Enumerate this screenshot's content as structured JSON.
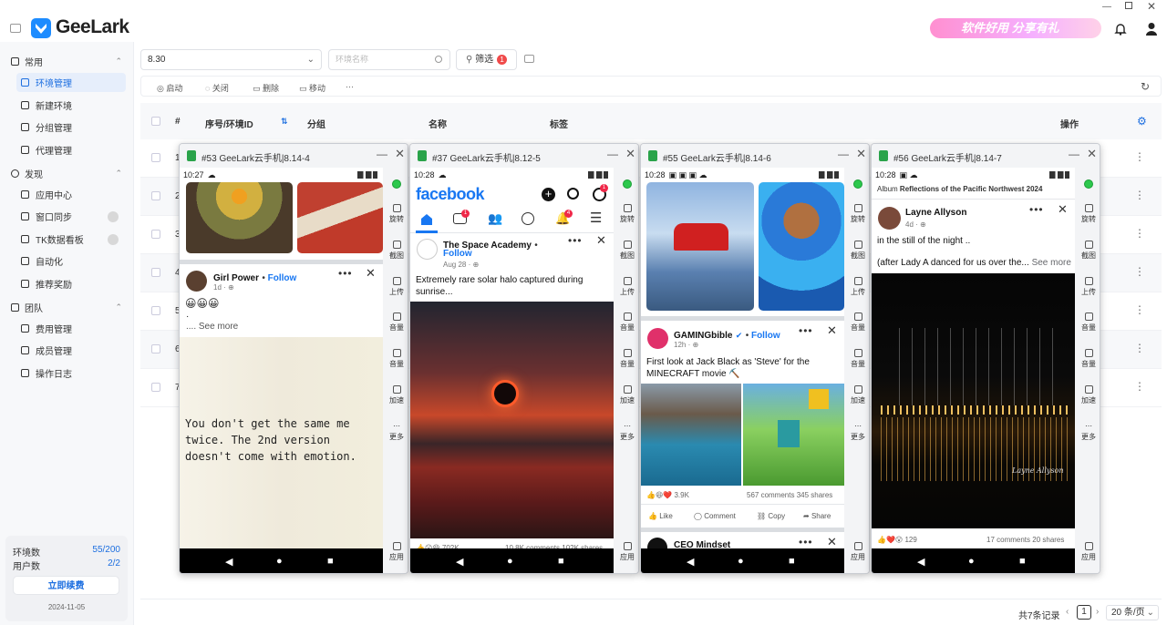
{
  "app": {
    "name": "GeeLark",
    "banner": "软件好用 分享有礼"
  },
  "sidebar": {
    "groups": [
      {
        "label": "常用",
        "items": [
          {
            "label": "环境管理",
            "active": true
          },
          {
            "label": "新建环境"
          },
          {
            "label": "分组管理"
          },
          {
            "label": "代理管理"
          }
        ]
      },
      {
        "label": "发现",
        "items": [
          {
            "label": "应用中心"
          },
          {
            "label": "窗口同步"
          },
          {
            "label": "TK数据看板"
          },
          {
            "label": "自动化"
          },
          {
            "label": "推荐奖励"
          }
        ]
      },
      {
        "label": "团队",
        "items": [
          {
            "label": "费用管理"
          },
          {
            "label": "成员管理"
          },
          {
            "label": "操作日志"
          }
        ]
      }
    ],
    "stats": [
      {
        "label": "环境数",
        "value": "55/200"
      },
      {
        "label": "用户数",
        "value": "2/2"
      }
    ],
    "renew_label": "立即续费",
    "expiry": "2024-11-05"
  },
  "toolbar": {
    "group_select": "8.30",
    "search_placeholder": "环境名称",
    "filter_label": "筛选",
    "filter_count": "1",
    "actions": [
      "启动",
      "关闭",
      "删除",
      "移动",
      "···"
    ]
  },
  "table": {
    "columns": [
      "#",
      "序号/环境ID",
      "分组",
      "名称",
      "标签",
      "操作"
    ],
    "rows": [
      "1",
      "2",
      "3",
      "4",
      "5",
      "6",
      "7"
    ],
    "total": "共7条记录",
    "page": "1",
    "page_size": "20 条/页"
  },
  "phone_side_buttons": [
    "旋转",
    "截图",
    "上传",
    "音量",
    "音量",
    "加速",
    "更多",
    "应用"
  ],
  "phones": [
    {
      "title": "#53 GeeLark云手机|8.14-4",
      "time": "10:27",
      "post_name": "Girl Power",
      "follow": "Follow",
      "meta": "1d · ",
      "emoji": "😀😀😀",
      "dot": "·",
      "see_more": ".... See more",
      "quote": "You don't get the same me twice. The 2nd version doesn't come with emotion."
    },
    {
      "title": "#37 GeeLark云手机|8.12-5",
      "time": "10:28",
      "brand": "facebook",
      "notif1": "1",
      "notif2": "4",
      "notif3": "1",
      "post_name": "The Space Academy",
      "follow": "Follow",
      "meta": "Aug 28 · ",
      "text": "Extremely rare solar halo captured during sunrise...",
      "reactions": "702K",
      "stats": "10.8K comments  102K shares"
    },
    {
      "title": "#55 GeeLark云手机|8.14-6",
      "time": "10:28",
      "post_name": "GAMINGbible",
      "follow": "Follow",
      "meta": "12h · ",
      "text": "First look at Jack Black as 'Steve' for the MINECRAFT movie ⛏️",
      "reactions": "3.9K",
      "stats": "567 comments  345 shares",
      "like": "Like",
      "comment": "Comment",
      "copy": "Copy",
      "share": "Share",
      "next_name": "CEO Mindset"
    },
    {
      "title": "#56 GeeLark云手机|8.14-7",
      "time": "10:28",
      "album_prefix": "Album",
      "album_name": "Reflections of the Pacific Northwest 2024",
      "post_name": "Layne Allyson",
      "meta": "4d · ",
      "line1": "in the still of the night ..",
      "line2": "(after Lady A danced for us over the...",
      "see_more": "See more",
      "signature": "Layne Allyson",
      "reactions": "129",
      "stats": "17 comments  20 shares"
    }
  ]
}
